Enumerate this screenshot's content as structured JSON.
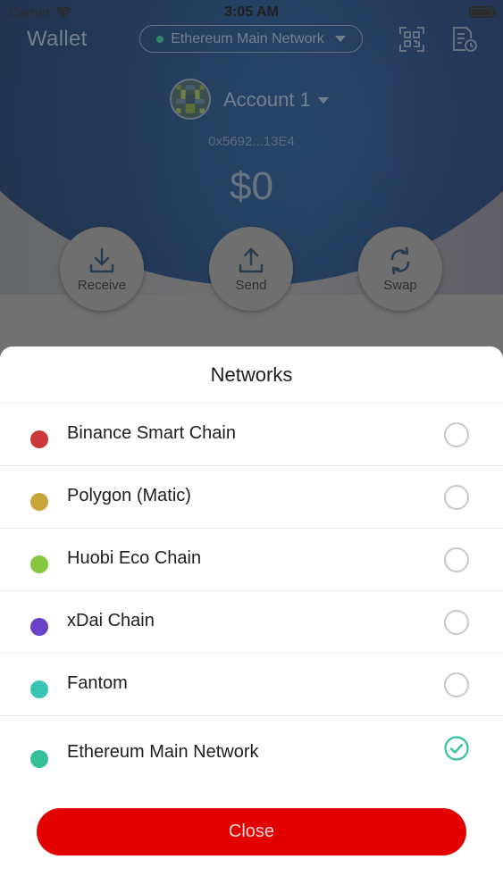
{
  "status_bar": {
    "carrier": "Carrier",
    "time": "3:05 AM"
  },
  "header": {
    "title": "Wallet",
    "network": "Ethereum Main Network",
    "network_dot_color": "#2fae7e"
  },
  "account": {
    "name": "Account 1",
    "address": "0x5692...13E4",
    "balance": "$0"
  },
  "actions": {
    "receive_label": "Receive",
    "send_label": "Send",
    "swap_label": "Swap"
  },
  "sheet": {
    "title": "Networks",
    "networks": [
      {
        "name": "Binance Smart Chain",
        "color": "#c9393b",
        "selected": false
      },
      {
        "name": "Polygon (Matic)",
        "color": "#c9a63b",
        "selected": false
      },
      {
        "name": "Huobi Eco Chain",
        "color": "#86c63f",
        "selected": false
      },
      {
        "name": "xDai Chain",
        "color": "#6b43c6",
        "selected": false
      },
      {
        "name": "Fantom",
        "color": "#3ac4b4",
        "selected": false
      },
      {
        "name": "Ethereum Main Network",
        "color": "#34c09a",
        "selected": true
      }
    ],
    "close_label": "Close",
    "accent_color": "#e30000",
    "check_color": "#2ec4a0"
  }
}
